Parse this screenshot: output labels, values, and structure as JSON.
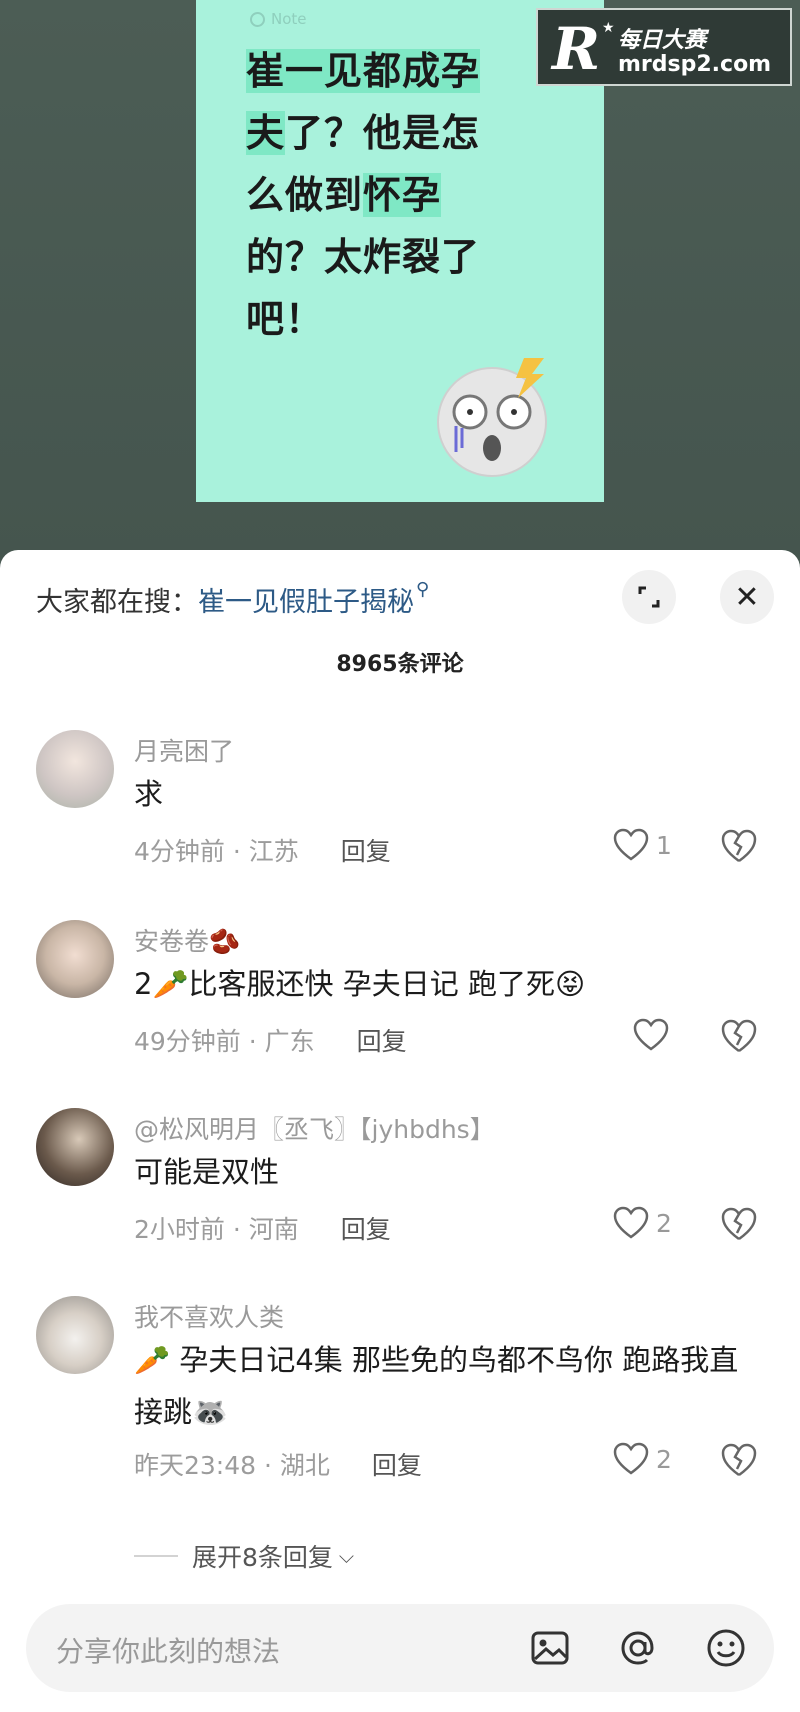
{
  "video": {
    "note_label": "Note",
    "headline_parts": [
      {
        "text": "崔一见都成孕",
        "hl": true
      },
      {
        "text": "夫",
        "hl": true
      },
      {
        "text": "了？他是怎",
        "hl": false
      },
      {
        "text": "么做到",
        "hl": false
      },
      {
        "text": "怀孕",
        "hl": true
      },
      {
        "text": "的？太炸裂了",
        "hl": false
      },
      {
        "text": "吧！",
        "hl": false
      }
    ],
    "watermark_cn": "每日大赛",
    "watermark_url": "mrdsp2.com",
    "watermark_logo": "R"
  },
  "sheet": {
    "search_prefix": "大家都在搜：",
    "search_term": "崔一见假肚子揭秘",
    "search_icon": "search-icon",
    "comment_count": "8965条评论"
  },
  "comments": [
    {
      "user": "月亮困了",
      "text": "求",
      "time": "4分钟前 · 江苏",
      "reply": "回复",
      "likes": "1"
    },
    {
      "user": "安卷卷🫘",
      "text": "2🥕比客服还快 孕夫日记 跑了死😝",
      "time": "49分钟前 · 广东",
      "reply": "回复",
      "likes": ""
    },
    {
      "user": "@松风明月〖丞飞〗【jyhbdhs】",
      "text": "可能是双性",
      "time": "2小时前 · 河南",
      "reply": "回复",
      "likes": "2"
    },
    {
      "user": "我不喜欢人类",
      "text": "🥕 孕夫日记4集 那些免的鸟都不鸟你 跑路我直接跳🦝",
      "time": "昨天23:48 · 湖北",
      "reply": "回复",
      "likes": "2"
    }
  ],
  "expand_replies": "展开8条回复",
  "input": {
    "placeholder": "分享你此刻的想法"
  },
  "colors": {
    "note_bg": "#a9f2dc",
    "highlight": "#7fe8c5",
    "link": "#2d5a86"
  }
}
